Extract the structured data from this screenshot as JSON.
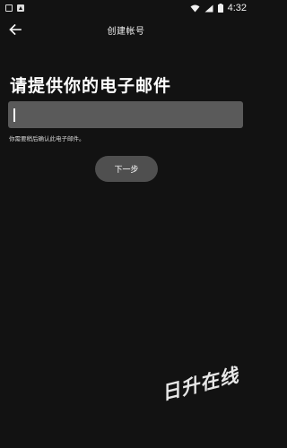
{
  "status_bar": {
    "time": "4:32"
  },
  "app_bar": {
    "title": "创建帐号"
  },
  "main": {
    "heading": "请提供你的电子邮件",
    "email_input": {
      "value": "",
      "placeholder": ""
    },
    "helper_text": "你需要稍后确认此电子邮件。",
    "next_label": "下一步"
  },
  "watermark_text": "日升在线",
  "colors": {
    "background": "#121212",
    "input_background": "#5a5a5a",
    "button_background": "#4f4f4f",
    "text": "#ffffff"
  }
}
